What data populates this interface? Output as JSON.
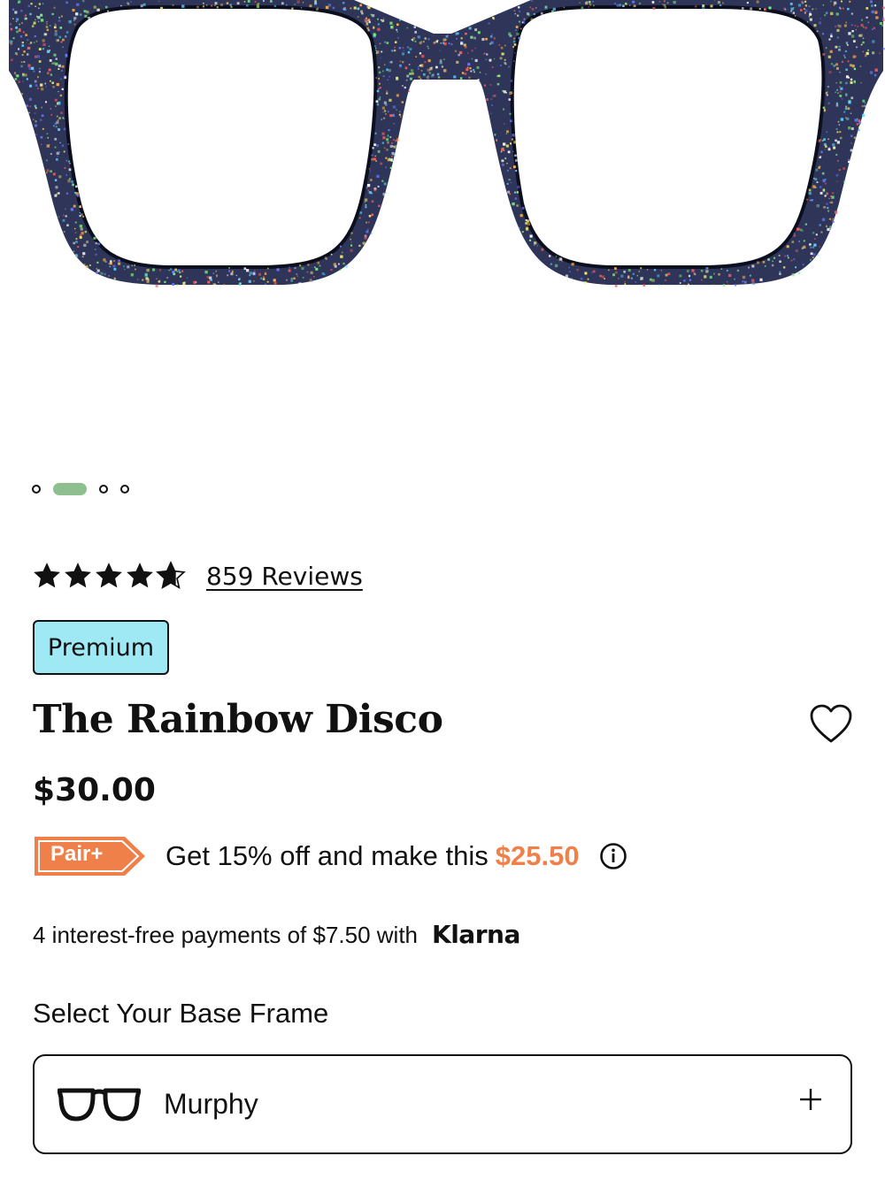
{
  "colors": {
    "frame_navy": "#2e3559",
    "dot_active": "#8fbf8f",
    "badge_bg": "#9fe9f5",
    "accent_orange": "#f0804a",
    "text": "#111111"
  },
  "product_image": {
    "alt": "",
    "carousel": {
      "total": 4,
      "active_index": 1
    }
  },
  "rating": {
    "stars": 4.7,
    "max": 5,
    "reviews_label": "859 Reviews"
  },
  "badge": {
    "label": "Premium"
  },
  "product": {
    "name": "The Rainbow Disco",
    "price": "$30.00"
  },
  "promo": {
    "tag": "Pair+",
    "text": "Get 15% off and make this",
    "discount_price": "$25.50",
    "info_icon": "info-icon"
  },
  "klarna": {
    "text": "4 interest-free payments of $7.50 with",
    "brand": "Klarna"
  },
  "base_frame": {
    "label": "Select Your Base Frame",
    "selected": "Murphy",
    "icon": "glasses-icon",
    "expand_icon": "plus-icon"
  },
  "favorite": {
    "icon": "heart-icon"
  }
}
